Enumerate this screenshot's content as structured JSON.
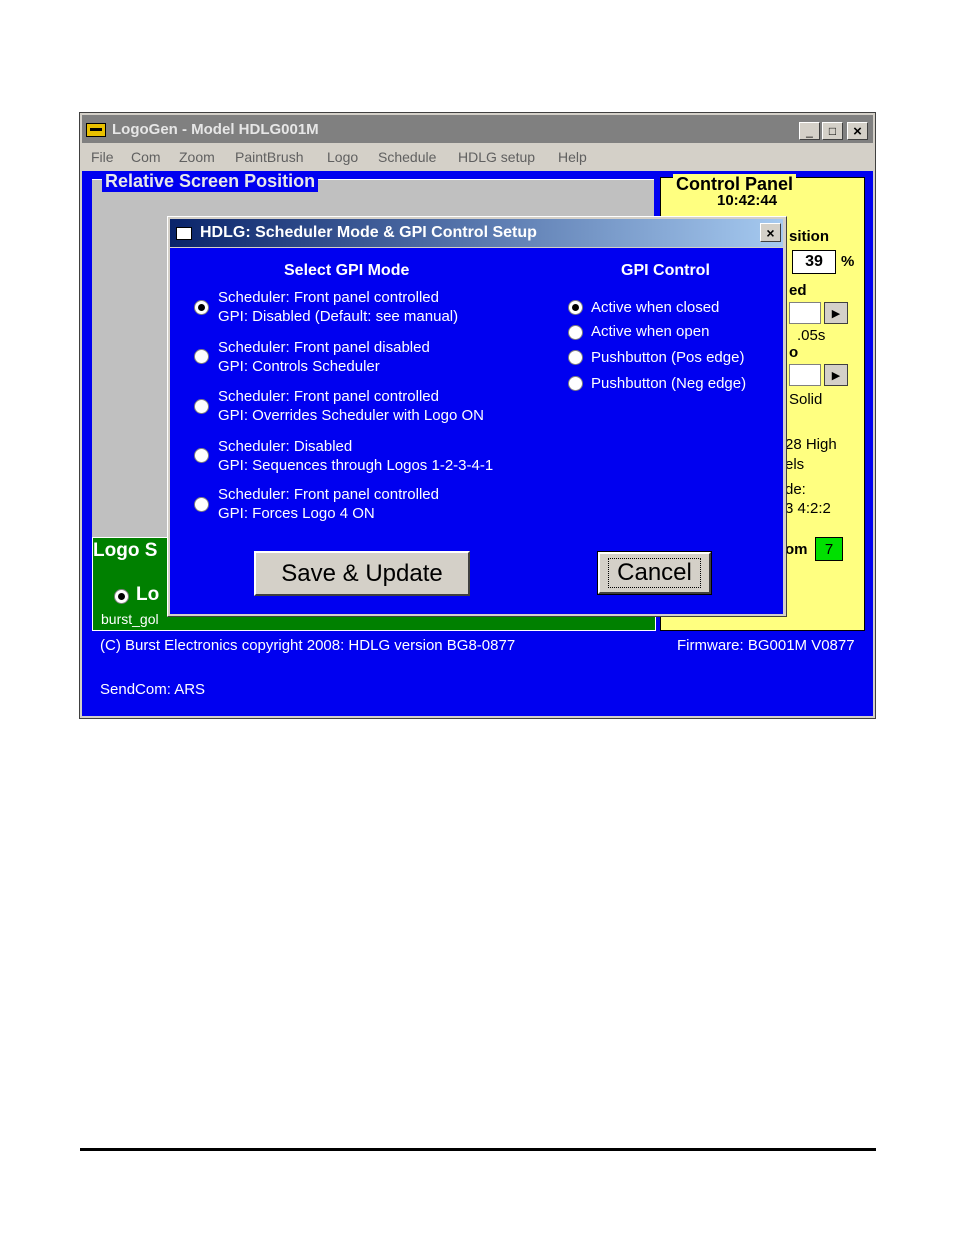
{
  "window": {
    "title": "LogoGen - Model HDLG001M",
    "minimize": "_",
    "maximize": "□",
    "close": "×"
  },
  "menu": [
    "File",
    "Com",
    "Zoom",
    "PaintBrush",
    "Logo",
    "Schedule",
    "HDLG setup",
    "Help"
  ],
  "relative_group": {
    "title": "Relative Screen Position"
  },
  "control_panel": {
    "title": "Control Panel",
    "time": "10:42:44",
    "position_label": "sition",
    "position_value": "39",
    "position_unit": "%",
    "speed_label": "ed",
    "speed_value": ".05s",
    "o_label": "o",
    "solid_label": "Solid",
    "high_label": "28 High",
    "pixels_label": "els",
    "mode_label": "de:",
    "mode_value": "3 4:2:2",
    "om_label": "om",
    "om_value": "7"
  },
  "logo_group": {
    "title": "Logo S",
    "radio_label": "Lo",
    "filename": "burst_gol"
  },
  "footer": {
    "copyright": "(C) Burst Electronics copyright 2008: HDLG version BG8-0877",
    "firmware": "Firmware: BG001M V0877",
    "sendcom": "SendCom: ARS"
  },
  "dialog": {
    "title": "HDLG: Scheduler Mode & GPI Control Setup",
    "close": "×",
    "gpi_mode_heading": "Select GPI Mode",
    "gpi_control_heading": "GPI Control",
    "gpi_modes": [
      {
        "line1": "Scheduler: Front panel controlled",
        "line2": "GPI: Disabled (Default: see manual)",
        "checked": true
      },
      {
        "line1": "Scheduler: Front panel disabled",
        "line2": "GPI: Controls Scheduler",
        "checked": false
      },
      {
        "line1": "Scheduler: Front panel controlled",
        "line2": "GPI: Overrides Scheduler with Logo ON",
        "checked": false
      },
      {
        "line1": "Scheduler: Disabled",
        "line2": "GPI: Sequences through Logos 1-2-3-4-1",
        "checked": false
      },
      {
        "line1": "Scheduler: Front panel controlled",
        "line2": "GPI: Forces Logo 4 ON",
        "checked": false
      }
    ],
    "gpi_controls": [
      {
        "label": "Active when closed",
        "checked": true
      },
      {
        "label": "Active when open",
        "checked": false
      },
      {
        "label": "Pushbutton (Pos edge)",
        "checked": false
      },
      {
        "label": "Pushbutton (Neg edge)",
        "checked": false
      }
    ],
    "save_label": "Save & Update",
    "cancel_label": "Cancel"
  },
  "colors": {
    "client_blue": "#0000f0",
    "panel_yellow": "#ffff80",
    "logo_green": "#008000",
    "title_gradient_start": "#0a246a",
    "title_gradient_end": "#a6caf0"
  }
}
